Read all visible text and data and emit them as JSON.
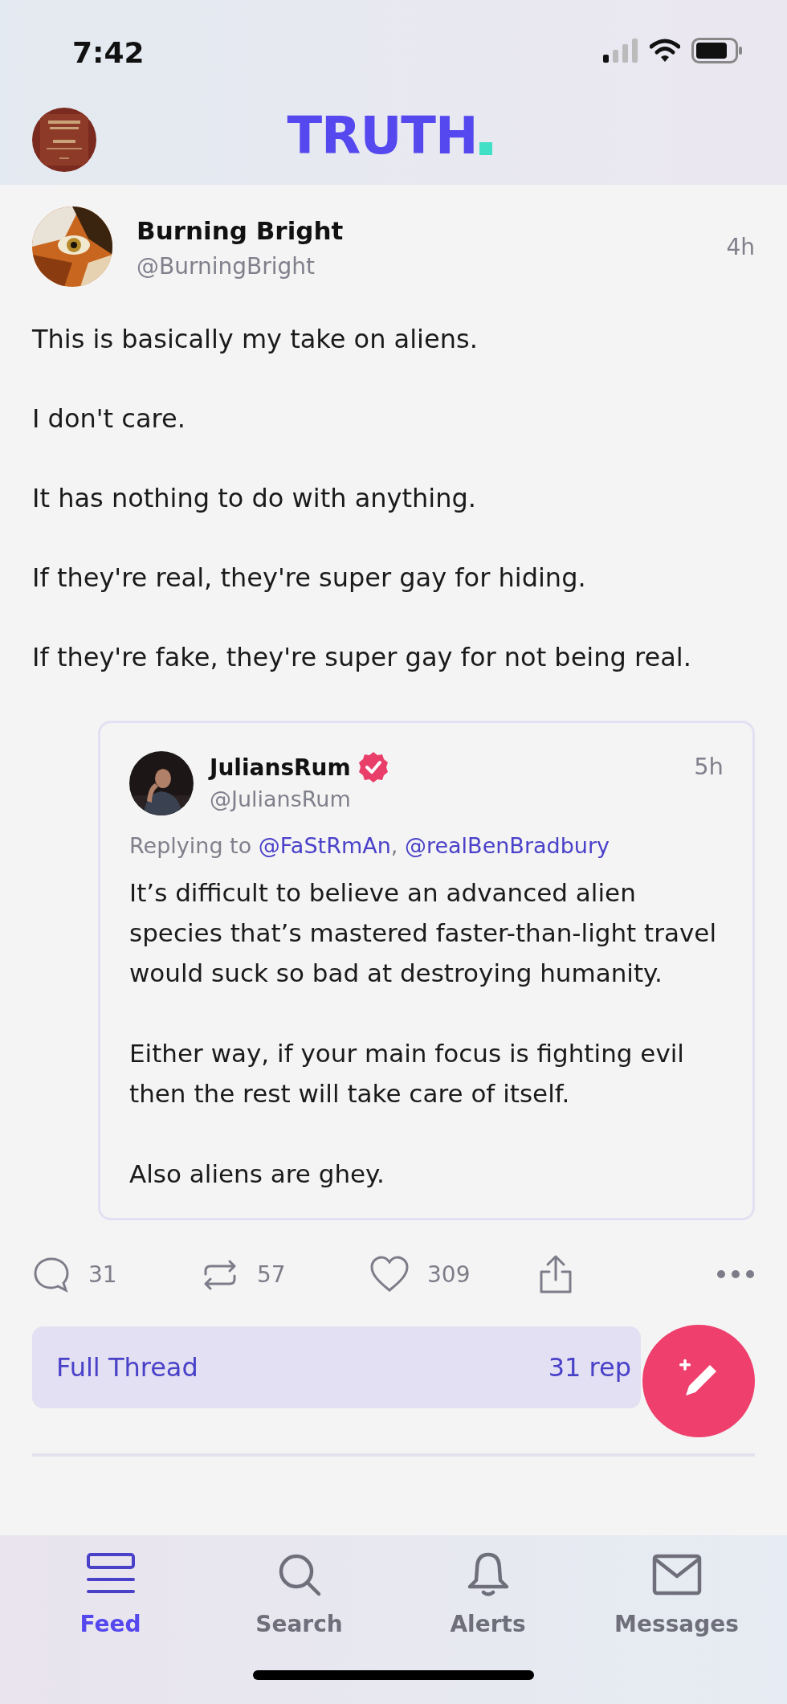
{
  "status_bar": {
    "time": "7:42"
  },
  "header": {
    "logo": "TRUTH"
  },
  "post": {
    "author": {
      "name": "Burning Bright",
      "handle": "@BurningBright"
    },
    "time": "4h",
    "paragraphs": [
      "This is basically my take on aliens.",
      "I don't care.",
      "It has nothing to do with anything.",
      "If they're real, they're super gay for hiding.",
      "If they're fake, they're super gay for not being real."
    ],
    "quote": {
      "author": {
        "name": "JuliansRum",
        "handle": "@JuliansRum",
        "verified": true
      },
      "time": "5h",
      "replying_to": {
        "label": "Replying to",
        "mentions": [
          {
            "text": "@FaStRmAn",
            "after": ","
          },
          {
            "text": "@realBenBradbury"
          }
        ]
      },
      "paragraphs": [
        "It’s difficult to believe an advanced alien species that’s mastered faster-than-light travel would suck so bad at destroying humanity.",
        "Either way, if your main focus is fighting evil then the rest will take care of itself.",
        "Also aliens are ghey."
      ]
    },
    "actions": [
      {
        "kind": "reply",
        "count": "31"
      },
      {
        "kind": "repost",
        "count": "57"
      },
      {
        "kind": "like",
        "count": "309"
      },
      {
        "kind": "share"
      },
      {
        "kind": "more"
      }
    ],
    "full_thread": {
      "label": "Full Thread",
      "replies": "31 rep"
    }
  },
  "tab_bar": {
    "items": [
      {
        "kind": "feed",
        "label": "Feed",
        "selected": true
      },
      {
        "kind": "search",
        "label": "Search",
        "selected": false
      },
      {
        "kind": "alerts",
        "label": "Alerts",
        "selected": false
      },
      {
        "kind": "messages",
        "label": "Messages",
        "selected": false
      }
    ]
  }
}
